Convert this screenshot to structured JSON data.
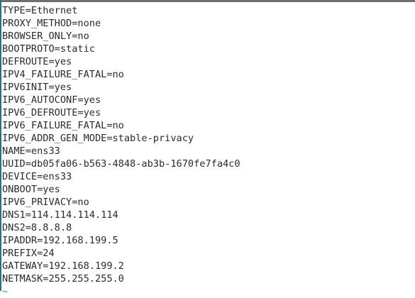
{
  "editor": {
    "lines": [
      "TYPE=Ethernet",
      "PROXY_METHOD=none",
      "BROWSER_ONLY=no",
      "BOOTPROTO=static",
      "DEFROUTE=yes",
      "IPV4_FAILURE_FATAL=no",
      "IPV6INIT=yes",
      "IPV6_AUTOCONF=yes",
      "IPV6_DEFROUTE=yes",
      "IPV6_FAILURE_FATAL=no",
      "IPV6_ADDR_GEN_MODE=stable-privacy",
      "NAME=ens33",
      "UUID=db05fa06-b563-4848-ab3b-1670fe7fa4c0",
      "DEVICE=ens33",
      "ONBOOT=yes",
      "IPV6_PRIVACY=no",
      "DNS1=114.114.114.114",
      "DNS2=8.8.8.8",
      "IPADDR=192.168.199.5",
      "PREFIX=24",
      "GATEWAY=192.168.199.2",
      "NETMASK=255.255.255.0"
    ],
    "empty_line_marker": "~"
  }
}
